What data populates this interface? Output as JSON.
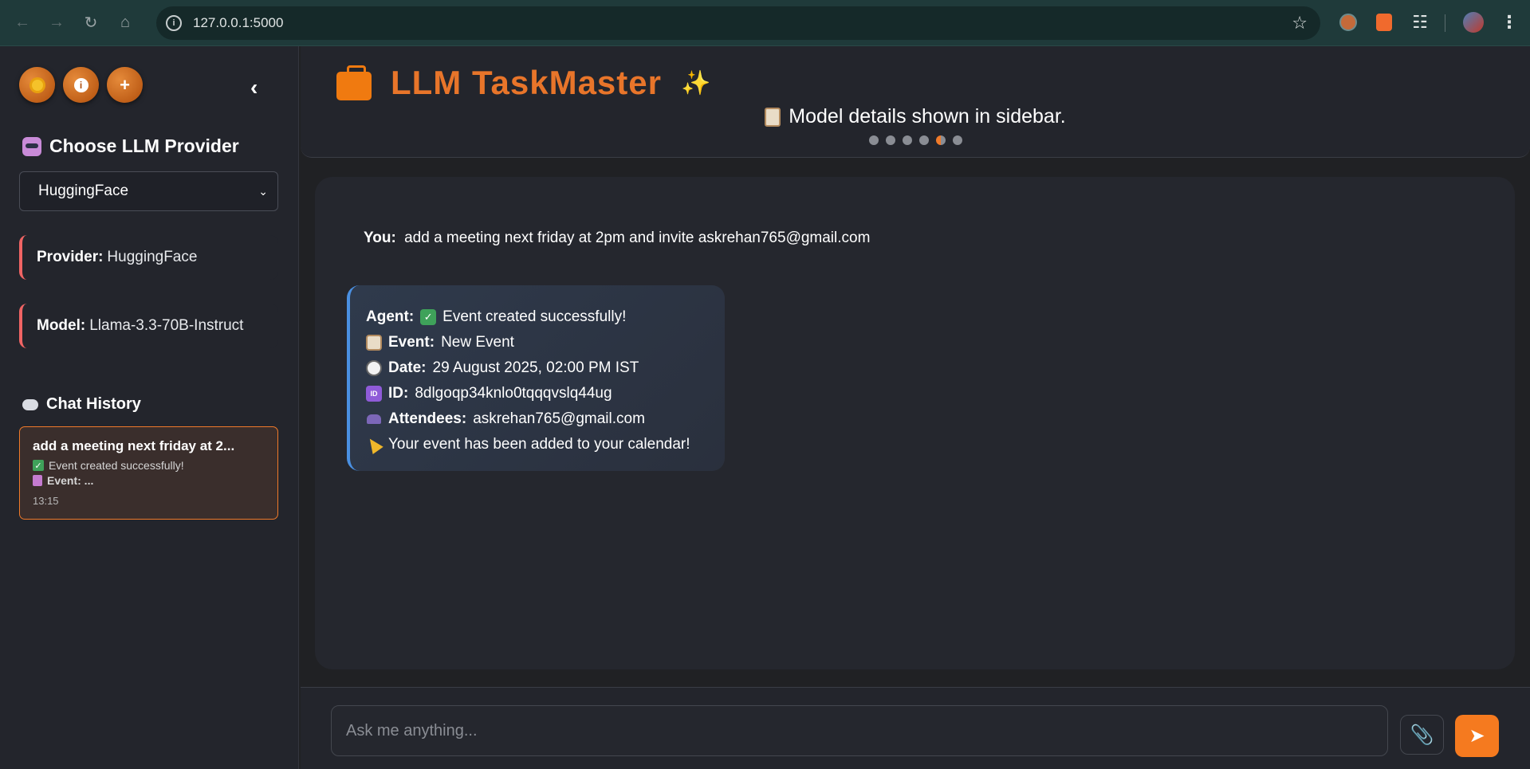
{
  "browser": {
    "url": "127.0.0.1:5000",
    "back_icon": "arrow-left-icon",
    "forward_icon": "arrow-right-icon",
    "reload_icon": "reload-icon",
    "home_icon": "home-icon"
  },
  "sidebar": {
    "provider_title": "Choose LLM Provider",
    "selected_provider": "HuggingFace",
    "provider_card": {
      "label": "Provider:",
      "value": "HuggingFace"
    },
    "model_card": {
      "label": "Model:",
      "value": "Llama-3.3-70B-Instruct"
    },
    "history_title": "Chat History",
    "history_items": [
      {
        "title": "add a meeting next friday at 2...",
        "line1": "Event created successfully!",
        "line2": "Event: ...",
        "time": "13:15"
      }
    ]
  },
  "header": {
    "title": "LLM TaskMaster",
    "subtitle": "Model details shown in sidebar.",
    "carousel_dots": 6,
    "active_dot": 5
  },
  "chat": {
    "user_message": {
      "label": "You:",
      "text": "add a meeting next friday at 2pm and invite askrehan765@gmail.com"
    },
    "agent_message": {
      "label": "Agent:",
      "status": "Event created successfully!",
      "event_label": "Event:",
      "event_value": "New Event",
      "date_label": "Date:",
      "date_value": "29 August 2025, 02:00 PM IST",
      "id_label": "ID:",
      "id_value": "8dlgoqp34knlo0tqqqvslq44ug",
      "attendees_label": "Attendees:",
      "attendees_value": "askrehan765@gmail.com",
      "footer": "Your event has been added to your calendar!"
    }
  },
  "input": {
    "placeholder": "Ask me anything...",
    "value": ""
  },
  "colors": {
    "accent": "#f57a1f",
    "brand": "#e8752a",
    "card_border": "#f06464",
    "agent_border": "#4a90e2"
  }
}
